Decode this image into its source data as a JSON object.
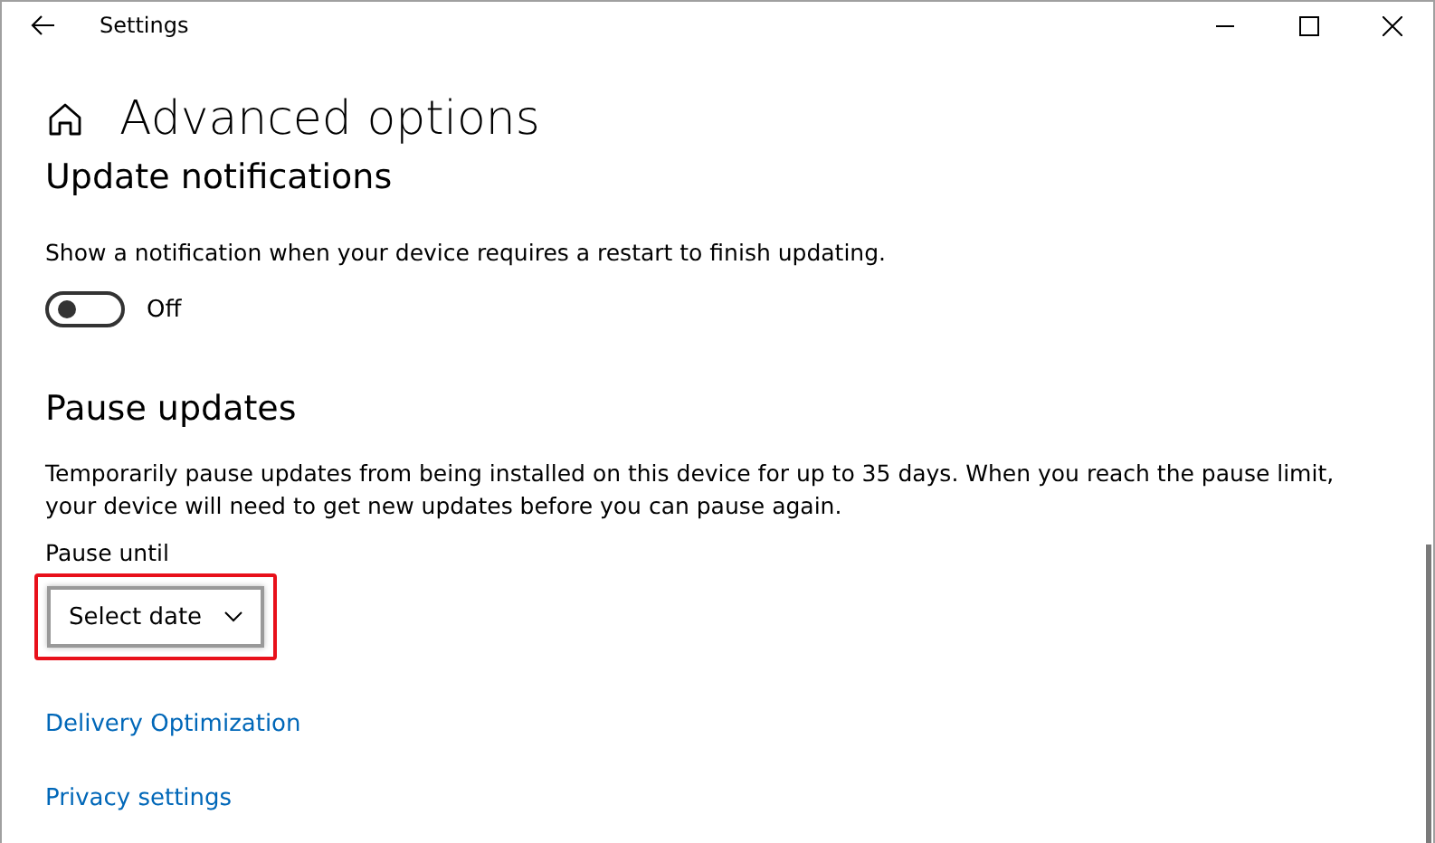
{
  "window": {
    "title": "Settings"
  },
  "page_title": "Advanced options",
  "sections": [
    {
      "kind": "toggle",
      "heading": "Update notifications",
      "description": "Show a notification when your device requires a restart to finish updating.",
      "toggle": {
        "on": false,
        "label": "Off"
      }
    },
    {
      "kind": "dropdown",
      "heading": "Pause updates",
      "description": "Temporarily pause updates from being installed on this device for up to 35 days. When you reach the pause limit, your device will need to get new updates before you can pause again.",
      "field_label": "Pause until",
      "dropdown": {
        "value": "Select date",
        "highlighted": true
      }
    }
  ],
  "links": [
    "Delivery Optimization",
    "Privacy settings"
  ]
}
